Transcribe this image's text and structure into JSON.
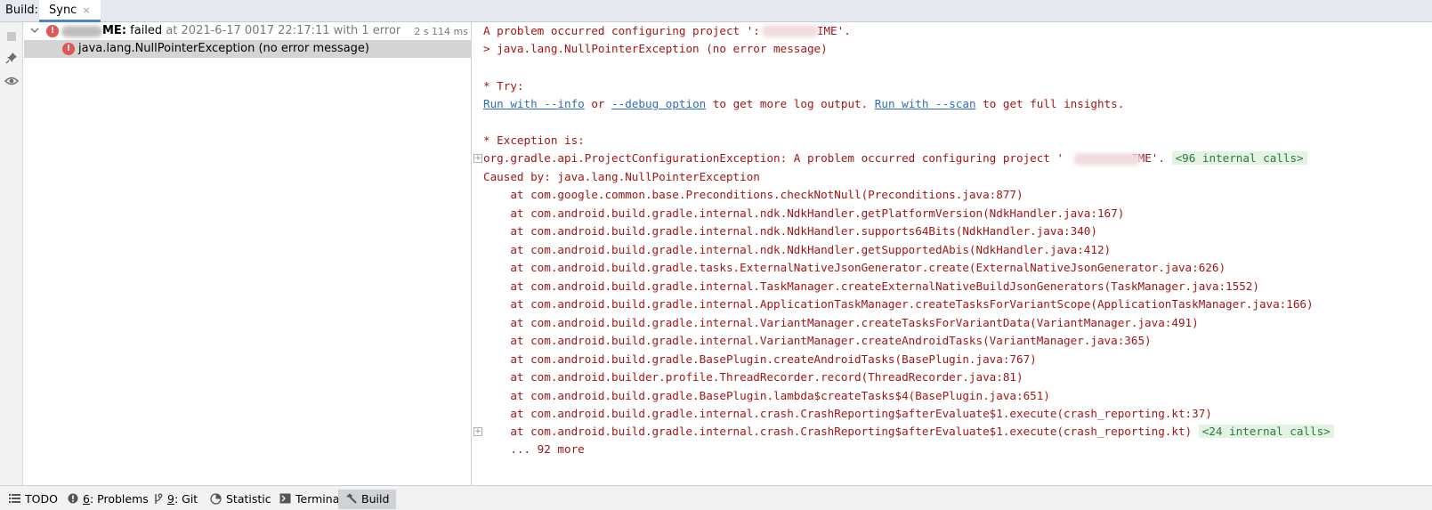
{
  "header": {
    "label": "Build:",
    "tab": "Sync",
    "tab_close": "×"
  },
  "tree": {
    "root": {
      "name_suffix": "ME:",
      "status": "failed",
      "detail": "at 2021-6-17 0017 22:17:11 with 1 error",
      "duration": "2 s 114 ms"
    },
    "child": {
      "label": "java.lang.NullPointerException (no error message)"
    }
  },
  "console": {
    "l1a": "A problem occurred configuring project ':",
    "l1b": "IME'.",
    "l2": "> java.lang.NullPointerException (no error message)",
    "l3": "* Try:",
    "l4_link1": "Run with --info",
    "l4_or": " or ",
    "l4_link2": "--debug option",
    "l4_mid": " to get more log output. ",
    "l4_link3": "Run with --scan",
    "l4_end": " to get full insights.",
    "l5": "* Exception is:",
    "l6a": "org.gradle.api.ProjectConfigurationException: A problem occurred configuring project '",
    "l6b": "IME'. ",
    "l6_fold": "<96 internal calls>",
    "l7": "Caused by: java.lang.NullPointerException",
    "stack": [
      "    at com.google.common.base.Preconditions.checkNotNull(Preconditions.java:877)",
      "    at com.android.build.gradle.internal.ndk.NdkHandler.getPlatformVersion(NdkHandler.java:167)",
      "    at com.android.build.gradle.internal.ndk.NdkHandler.supports64Bits(NdkHandler.java:340)",
      "    at com.android.build.gradle.internal.ndk.NdkHandler.getSupportedAbis(NdkHandler.java:412)",
      "    at com.android.build.gradle.tasks.ExternalNativeJsonGenerator.create(ExternalNativeJsonGenerator.java:626)",
      "    at com.android.build.gradle.internal.TaskManager.createExternalNativeBuildJsonGenerators(TaskManager.java:1552)",
      "    at com.android.build.gradle.internal.ApplicationTaskManager.createTasksForVariantScope(ApplicationTaskManager.java:166)",
      "    at com.android.build.gradle.internal.VariantManager.createTasksForVariantData(VariantManager.java:491)",
      "    at com.android.build.gradle.internal.VariantManager.createAndroidTasks(VariantManager.java:365)",
      "    at com.android.build.gradle.BasePlugin.createAndroidTasks(BasePlugin.java:767)",
      "    at com.android.builder.profile.ThreadRecorder.record(ThreadRecorder.java:81)",
      "    at com.android.build.gradle.BasePlugin.lambda$createTasks$4(BasePlugin.java:651)",
      "    at com.android.build.gradle.internal.crash.CrashReporting$afterEvaluate$1.execute(crash_reporting.kt:37)"
    ],
    "l_last": "    at com.android.build.gradle.internal.crash.CrashReporting$afterEvaluate$1.execute(crash_reporting.kt) ",
    "l_last_fold": "<24 internal calls>",
    "more": "    ... 92 more"
  },
  "bottom": {
    "todo": "TODO",
    "problems_num": "6",
    "problems": ": Problems",
    "git_num": "9",
    "git": ": Git",
    "statistic": "Statistic",
    "terminal": "Terminal",
    "build": "Build"
  }
}
